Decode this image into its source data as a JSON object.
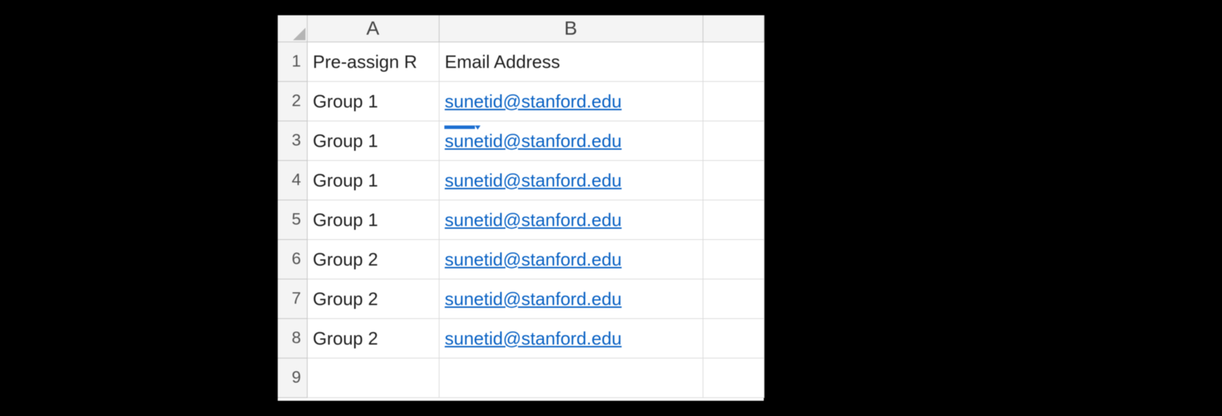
{
  "columns": {
    "A": "A",
    "B": "B",
    "C": ""
  },
  "rowNumbers": [
    "1",
    "2",
    "3",
    "4",
    "5",
    "6",
    "7",
    "8",
    "9"
  ],
  "header": {
    "A": "Pre-assign R",
    "B": "Email Address"
  },
  "rows": [
    {
      "A": "Group 1",
      "B": "sunetid@stanford.edu"
    },
    {
      "A": "Group 1",
      "B": "sunetid@stanford.edu"
    },
    {
      "A": "Group 1",
      "B": "sunetid@stanford.edu"
    },
    {
      "A": "Group 1",
      "B": "sunetid@stanford.edu"
    },
    {
      "A": "Group 2",
      "B": "sunetid@stanford.edu"
    },
    {
      "A": "Group 2",
      "B": "sunetid@stanford.edu"
    },
    {
      "A": "Group 2",
      "B": "sunetid@stanford.edu"
    }
  ],
  "linkColor": "#0a62c4"
}
